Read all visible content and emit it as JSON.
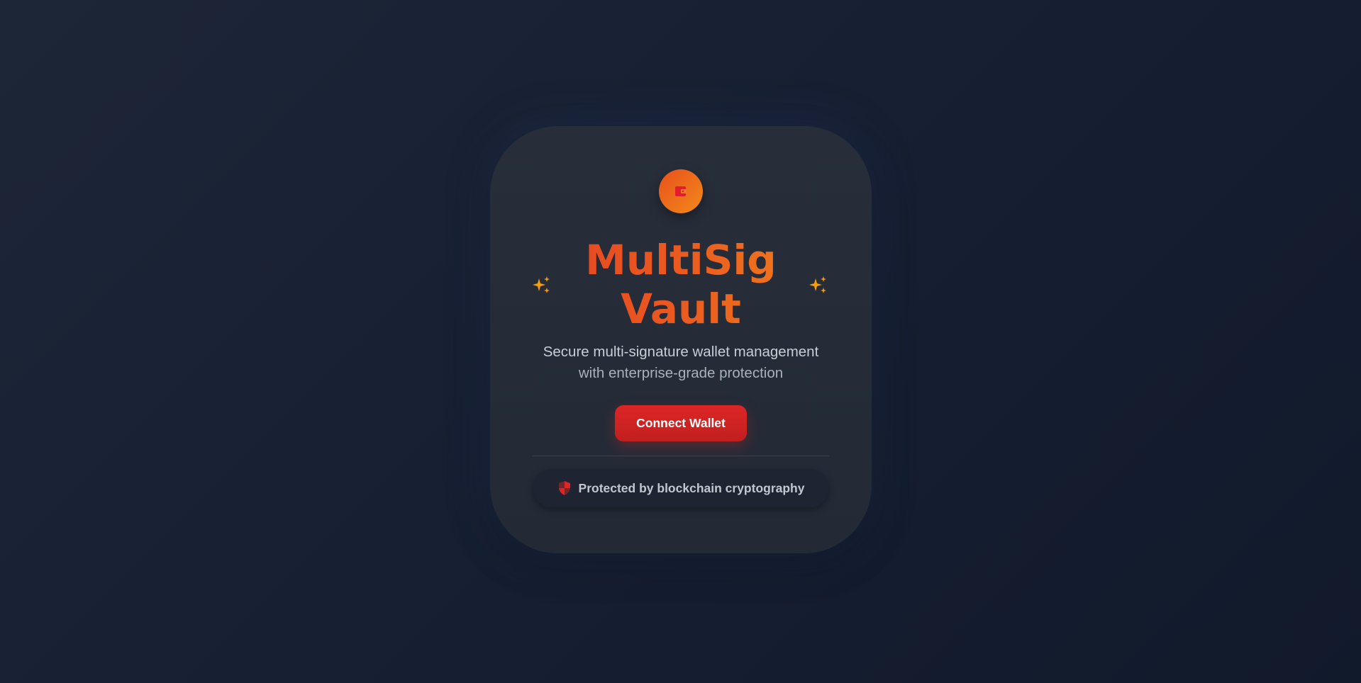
{
  "app": {
    "title_line1": "MultiSig",
    "title_line2": "Vault",
    "subtitle_line1": "Secure multi-signature wallet management",
    "subtitle_line2": "with enterprise-grade protection"
  },
  "actions": {
    "connect_label": "Connect Wallet"
  },
  "footer": {
    "protected_text": "Protected by blockchain cryptography"
  },
  "icons": {
    "logo": "wallet-icon",
    "decor": "sparkles-icon",
    "badge": "shield-icon"
  },
  "colors": {
    "accent_start": "#e53e22",
    "accent_end": "#f28a1a",
    "button": "#dc2626",
    "sparkle": "#f59e0b",
    "shield": "#dc2626"
  }
}
